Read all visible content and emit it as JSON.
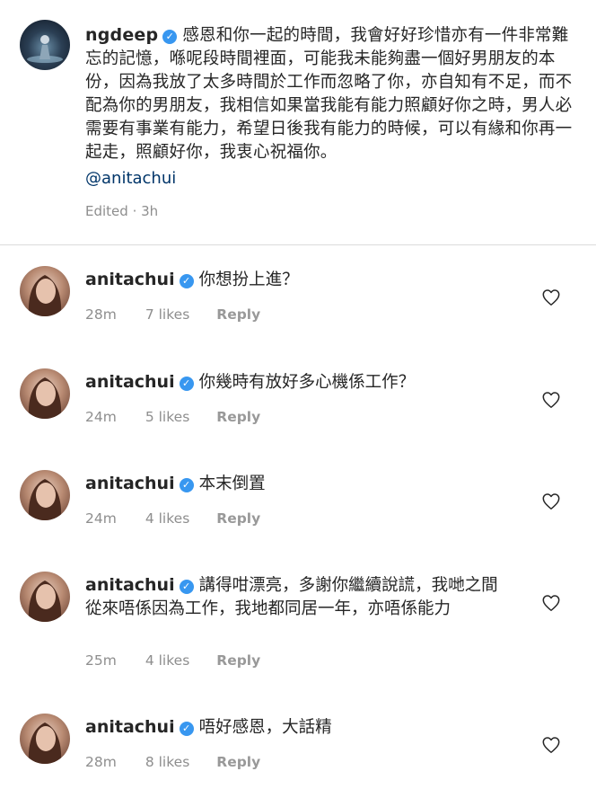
{
  "caption": {
    "username": "ngdeep",
    "text": "感恩和你一起的時間，我會好好珍惜亦有一件非常難忘的記憶，喺呢段時間裡面，可能我未能夠盡一個好男朋友的本份，因為我放了太多時間於工作而忽略了你，亦自知有不足，而不配為你的男朋友，我相信如果當我能有能力照顧好你之時，男人必需要有事業有能力，希望日後我有能力的時候，可以有緣和你再一起走，照顧好你，我衷心祝福你。",
    "mention": "@anitachui",
    "edited": "Edited · 3h"
  },
  "comments": [
    {
      "username": "anitachui",
      "text": "你想扮上進？",
      "time": "28m",
      "likes": "7 likes",
      "reply": "Reply"
    },
    {
      "username": "anitachui",
      "text": "你幾時有放好多心機係工作？",
      "time": "24m",
      "likes": "5 likes",
      "reply": "Reply"
    },
    {
      "username": "anitachui",
      "text": "本末倒置",
      "time": "24m",
      "likes": "4 likes",
      "reply": "Reply"
    },
    {
      "username": "anitachui",
      "text": "講得咁漂亮，多謝你繼續說謊，我哋之間從來唔係因為工作，我地都同居一年，亦唔係能力",
      "time": "25m",
      "likes": "4 likes",
      "reply": "Reply"
    },
    {
      "username": "anitachui",
      "text": "唔好感恩，大話精",
      "time": "28m",
      "likes": "8 likes",
      "reply": "Reply"
    }
  ],
  "icons": {
    "verified": "verified-badge-icon",
    "like": "heart-outline-icon"
  },
  "colors": {
    "verified": "#3897f0",
    "mention": "#003569",
    "meta": "#8e8e8e",
    "divider": "#dbdbdb"
  }
}
